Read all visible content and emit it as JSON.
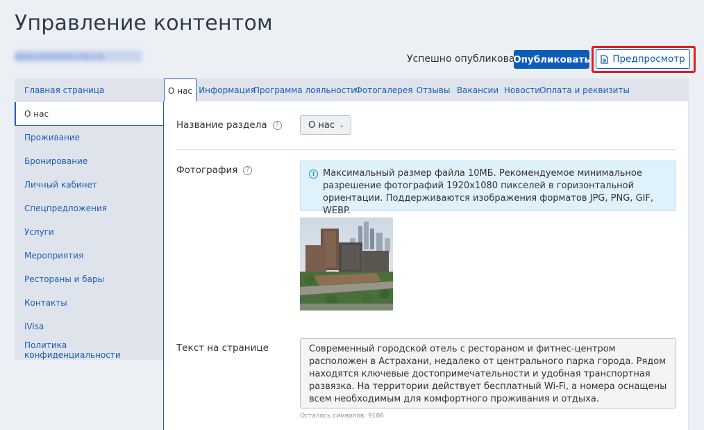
{
  "page": {
    "title": "Управление контентом",
    "site_url": "www.nnnnnnnnn.nnn.nn"
  },
  "header": {
    "status": "Успешно опубликовано",
    "publish_label": "Опубликовать",
    "preview_label": "Предпросмотр"
  },
  "sidebar": {
    "items": [
      {
        "label": "Главная страница"
      },
      {
        "label": "О нас",
        "active": true
      },
      {
        "label": "Проживание"
      },
      {
        "label": "Бронирование"
      },
      {
        "label": "Личный кабинет"
      },
      {
        "label": "Спецпредложения"
      },
      {
        "label": "Услуги"
      },
      {
        "label": "Мероприятия"
      },
      {
        "label": "Рестораны и бары"
      },
      {
        "label": "Контакты"
      },
      {
        "label": "iVisa"
      },
      {
        "label": "Политика конфиденциальности"
      }
    ]
  },
  "tabs": [
    {
      "label": "О нас",
      "active": true
    },
    {
      "label": "Информация"
    },
    {
      "label": "Программа лояльности"
    },
    {
      "label": "Фотогалерея"
    },
    {
      "label": "Отзывы"
    },
    {
      "label": "Вакансии"
    },
    {
      "label": "Новости"
    },
    {
      "label": "Оплата и реквизиты"
    }
  ],
  "form": {
    "section_name_label": "Название раздела",
    "section_name_value": "О нас",
    "photo_label": "Фотография",
    "photo_info": "Максимальный размер файла 10МБ. Рекомендуемое минимальное разрешение фотографий 1920x1080 пикселей в горизонтальной ориентации. Поддерживаются изображения форматов JPG, PNG, GIF, WEBP.",
    "text_label": "Текст на странице",
    "text_value": "Современный городской отель с рестораном и фитнес-центром расположен в Астрахани, недалеко от центрального парка города. Рядом находятся ключевые достопримечательности и удобная транспортная развязка. На территории действует бесплатный Wi-Fi, а номера оснащены всем необходимым для комфортного проживания и отдыха.",
    "chars_left": "Осталось символов: 9186"
  },
  "colors": {
    "accent": "#0d5cb6",
    "highlight": "#e01e1e",
    "sidebar_bg": "#dee3ec",
    "info_bg": "#dff1fb"
  }
}
